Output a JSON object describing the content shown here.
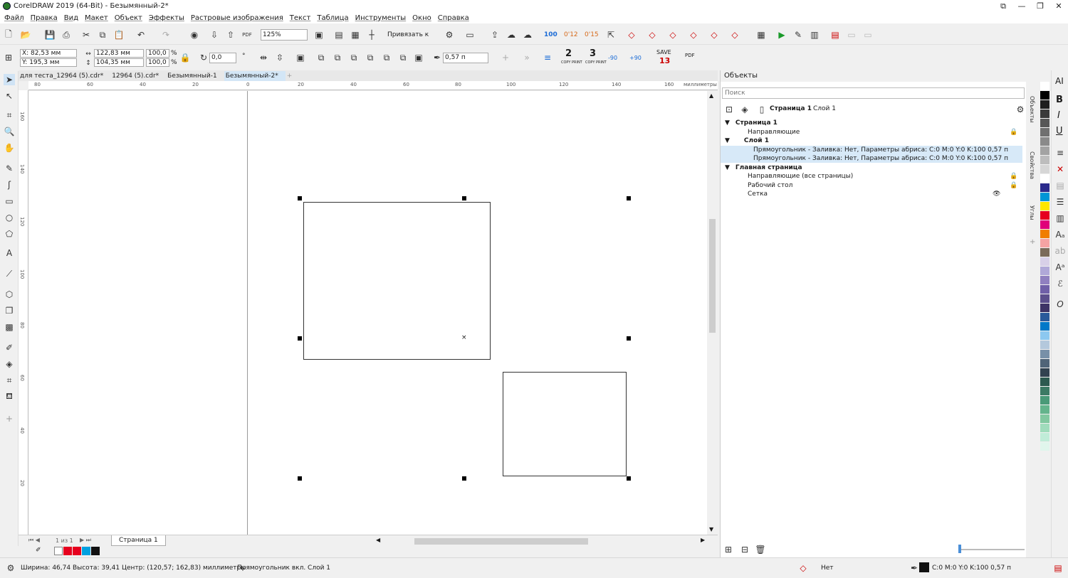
{
  "titlebar": {
    "title": "CorelDRAW 2019 (64-Bit) - Безымянный-2*"
  },
  "menu": [
    "Файл",
    "Правка",
    "Вид",
    "Макет",
    "Объект",
    "Эффекты",
    "Растровые изображения",
    "Текст",
    "Таблица",
    "Инструменты",
    "Окно",
    "Справка"
  ],
  "toolbar": {
    "zoom": "125%",
    "snap_label": "Привязать к",
    "btn_100": "100",
    "btn_012": "0'12",
    "btn_015": "0'15",
    "print2": "2",
    "print3": "3",
    "print_label": "COPY PRINT",
    "rot_minus": "-90",
    "rot_plus": "+90",
    "save_label": "SAVE",
    "save_num": "13",
    "pdf": "PDF"
  },
  "props": {
    "x": "X: 82,53 мм",
    "y": "Y: 195,3 мм",
    "w": "122,83 мм",
    "h": "104,35 мм",
    "sx": "100,0",
    "sy": "100,0",
    "pct": "%",
    "angle": "0,0",
    "outline": "0,57 п"
  },
  "doc_tabs": [
    "для теста_12964 (5).cdr*",
    "12964 (5).cdr*",
    "Безымянный-1",
    "Безымянный-2*"
  ],
  "ruler": {
    "h": [
      "80",
      "60",
      "40",
      "20",
      "0",
      "20",
      "40",
      "60",
      "80",
      "100",
      "120",
      "140",
      "160"
    ],
    "units": "миллиметры",
    "v": [
      "160",
      "140",
      "120",
      "100",
      "80",
      "60",
      "40",
      "20"
    ]
  },
  "page_nav": {
    "counter": "1  из  1",
    "page_tab": "Страница 1"
  },
  "status": {
    "dims": "Ширина: 46,74  Высота: 39,41  Центр: (120,57; 162,83)  миллиметры",
    "selection": "Прямоугольник вкл. Слой 1",
    "fill": "Нет",
    "outline": "C:0 M:0 Y:0 K:100  0,57 п"
  },
  "objects": {
    "title": "Объекты",
    "search": "Поиск",
    "page": "Страница 1",
    "layer": "Слой 1",
    "tree": [
      {
        "label": "Страница 1",
        "bold": true
      },
      {
        "label": "Направляющие",
        "bold": false
      },
      {
        "label": "Слой 1",
        "bold": true
      },
      {
        "label": "Прямоугольник - Заливка: Нет, Параметры абриса: C:0 M:0 Y:0 K:100  0,57 п",
        "bold": false
      },
      {
        "label": "Прямоугольник - Заливка: Нет, Параметры абриса: C:0 M:0 Y:0 K:100  0,57 п",
        "bold": false
      },
      {
        "label": "Главная страница",
        "bold": true
      },
      {
        "label": "Направляющие (все страницы)",
        "bold": false
      },
      {
        "label": "Рабочий стол",
        "bold": false
      },
      {
        "label": "Сетка",
        "bold": false
      }
    ]
  },
  "side_tabs": [
    "Объекты",
    "Свойства",
    "Углы"
  ],
  "palette": [
    "#ffffff",
    "#000000",
    "#1e1e1e",
    "#3a3a3a",
    "#575757",
    "#707070",
    "#8a8a8a",
    "#a3a3a3",
    "#bdbdbd",
    "#d6d6d6",
    "#ffffff",
    "#2b2b8c",
    "#0096d6",
    "#ffe600",
    "#e6001e",
    "#e0007a",
    "#f07d00",
    "#f5a3a3",
    "#7a6a5a",
    "#d8d0e8",
    "#b0a8d8",
    "#9080c0",
    "#7060a8",
    "#5c4f8c",
    "#3e3466",
    "#2a5a9a",
    "#0078c8",
    "#8cc8f0",
    "#b4c8dc",
    "#7890a8",
    "#506478",
    "#324250",
    "#2d5a50",
    "#3c7a64",
    "#4a9a78",
    "#64b48c",
    "#82c8a0",
    "#a0dcbc",
    "#c0ecd8",
    "#e0f6ec"
  ],
  "rightbar_icons": [
    "AI",
    "B",
    "I",
    "U"
  ]
}
